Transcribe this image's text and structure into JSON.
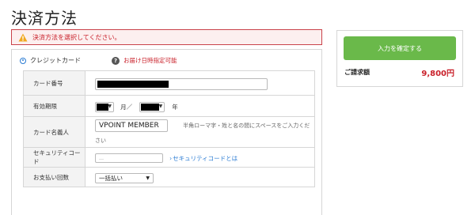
{
  "page": {
    "title": "決済方法"
  },
  "alert": {
    "message": "決済方法を選択してください。"
  },
  "payment": {
    "option_label": "クレジットカード",
    "help_text": "お届け日時指定可能",
    "help_icon": "question-circle-icon",
    "rows": {
      "card_number": {
        "label": "カード番号"
      },
      "expiry": {
        "label": "有効期限",
        "month_unit": "月／",
        "year_unit": "年"
      },
      "card_holder": {
        "label": "カード名義人",
        "value": "VPOINT MEMBER",
        "hint": "半角ローマ字・姓と名の間にスペースをご入力ください"
      },
      "security_code": {
        "label": "セキュリティコード",
        "placeholder": "…",
        "link": "セキュリティコードとは"
      },
      "installments": {
        "label": "お支払い回数",
        "selected": "一括払い"
      }
    }
  },
  "summary": {
    "confirm_button": "入力を確定する",
    "total_label": "ご請求額",
    "total_value": "9,800円"
  },
  "colors": {
    "accent_green": "#6ab94a",
    "error_red": "#c9202a",
    "link_blue": "#2a7bd3"
  }
}
